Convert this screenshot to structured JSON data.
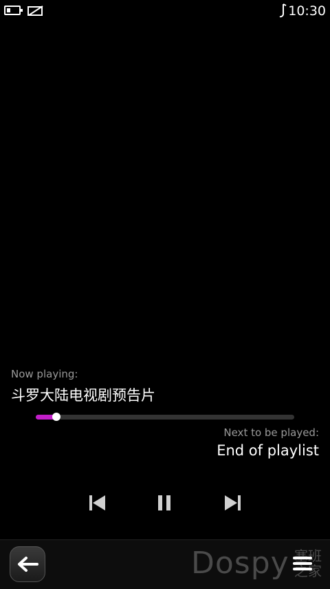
{
  "status_bar": {
    "time": "10:30"
  },
  "player": {
    "now_playing_label": "Now playing:",
    "track_title": "斗罗大陆电视剧预告片",
    "progress_fraction": 0.08,
    "next_label": "Next to be played:",
    "next_value": "End of playlist"
  },
  "controls": [
    "previous-icon",
    "pause-icon",
    "next-icon"
  ],
  "toolbar": {
    "watermark": "Dospy",
    "watermark_sub": "塞班之家"
  },
  "colors": {
    "accent": "#c21ec9",
    "background": "#000000",
    "secondary_text": "#9a9a9a"
  }
}
